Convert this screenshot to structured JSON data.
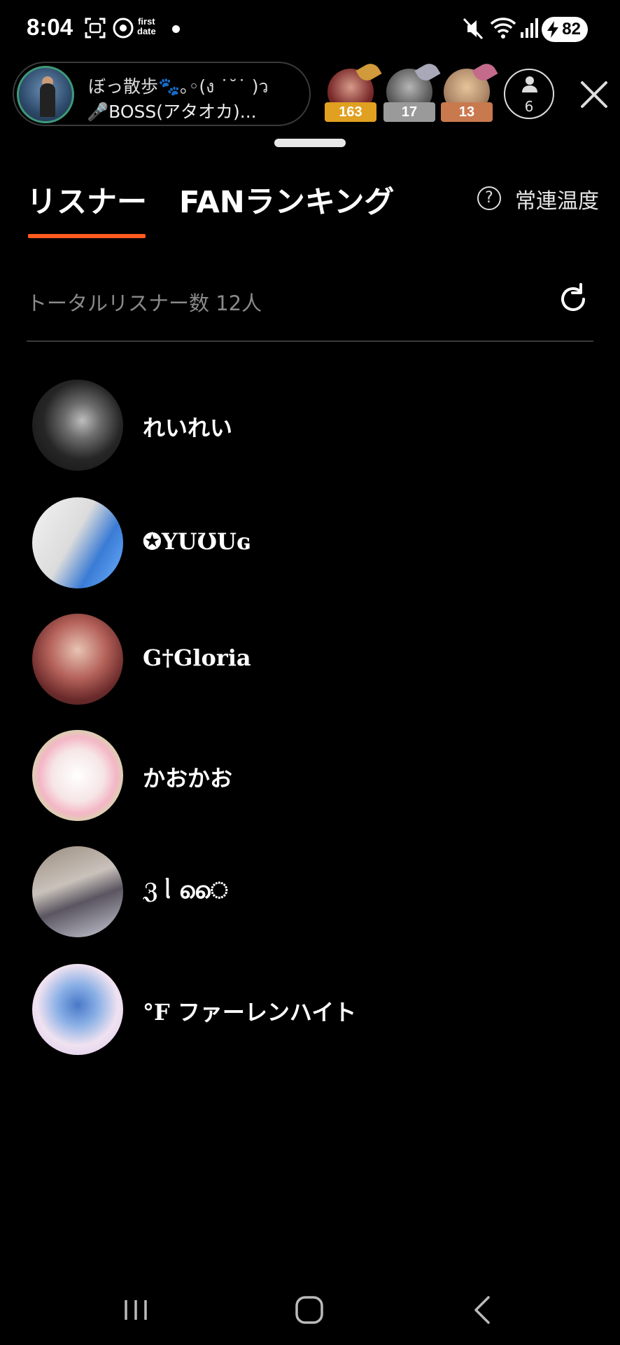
{
  "status_bar": {
    "time": "8:04",
    "first_date_line1": "first",
    "first_date_line2": "date",
    "battery": "82"
  },
  "room": {
    "title": "ぼっ散歩🐾｡◦(ง ˙˘˙ )ว",
    "host": "🎤BOSS(アタオカ)...",
    "fans": [
      {
        "count": "163",
        "color": "#e0a020",
        "wing": "#d19a3a",
        "pic": "#7a2a2a"
      },
      {
        "count": "17",
        "color": "#9a9a9a",
        "wing": "#a8a8b8",
        "pic": "#5a5a5a"
      },
      {
        "count": "13",
        "color": "#c9794e",
        "wing": "#c46a8a",
        "pic": "#b08a6a"
      }
    ],
    "viewer_count": "6"
  },
  "tabs": {
    "listener": "リスナー",
    "fan_ranking": "FANランキング",
    "regular_temperature": "常連温度",
    "help_icon": "?"
  },
  "listeners": {
    "total_label": "トータルリスナー数 12人",
    "items": [
      {
        "name": "れいれい",
        "avatar_bg": "radial-gradient(circle at 55% 45%, #bdbdbd 0%, #6d6d6d 25%, #262626 55%, #111 100%)"
      },
      {
        "name": "✪YUƱUɢ",
        "avatar_bg": "linear-gradient(120deg, #f2f2f2 0%, #dcdcdc 45%, #3a7bd5 70%, #6fb2ff 100%)"
      },
      {
        "name": "G†Gloria",
        "avatar_bg": "radial-gradient(circle at 50% 40%, #e8c4b4 0%, #b5625a 40%, #6a2a2a 70%, #3a1e1e 100%)"
      },
      {
        "name": "かおかお",
        "avatar_bg": "radial-gradient(circle at 50% 50%, #ffffff 0%, #f6e6e6 40%, #f4b6c6 60%, #c8e6a0 80%, #f7d6a0 100%)"
      },
      {
        "name": "ℨ ᥣ ൈ",
        "avatar_bg": "linear-gradient(160deg, #9a8c7e 0%, #c9c2bb 40%, #5a5560 60%, #c8cad6 100%)"
      },
      {
        "name": "°F ファーレンハイト",
        "avatar_bg": "radial-gradient(circle at 50% 45%, #4a78c8 0%, #8ab0e6 30%, #f0e2f0 60%, #d6c2ec 100%)"
      }
    ]
  }
}
